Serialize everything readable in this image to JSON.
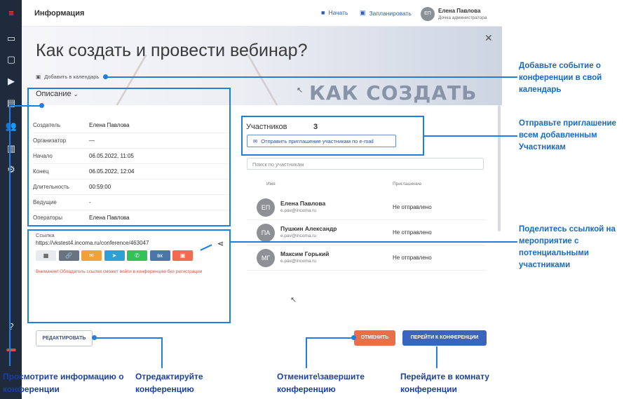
{
  "sidebar": {
    "icons": [
      "menu-icon",
      "calendar-icon",
      "chat-icon",
      "play-icon",
      "message-icon",
      "users-icon",
      "stats-icon",
      "settings-icon",
      "help-icon",
      "flag-icon"
    ]
  },
  "topbar": {
    "title": "Информация",
    "start_label": "Начать",
    "schedule_label": "Запланировать",
    "user_initials": "ЕП",
    "user_name": "Елена Павлова",
    "user_role": "Дочка администратора"
  },
  "hero": {
    "title": "Как создать и провести вебинар?",
    "bg_text": "КАК СОЗДАТЬ",
    "add_calendar": "Добавить в календарь"
  },
  "description": {
    "header": "Описание",
    "rows": [
      {
        "key": "Создатель",
        "value": "Елена Павлова"
      },
      {
        "key": "Организатор",
        "value": "—"
      },
      {
        "key": "Начало",
        "value": "06.05.2022, 11:05"
      },
      {
        "key": "Конец",
        "value": "06.05.2022, 12:04"
      },
      {
        "key": "Длительность",
        "value": "00:59:00"
      },
      {
        "key": "Ведущие",
        "value": "-"
      },
      {
        "key": "Операторы",
        "value": "Елена Павлова"
      }
    ]
  },
  "link": {
    "label": "Ссылка",
    "url": "https://vkstest4.incoma.ru/conference/463047",
    "buttons": [
      {
        "name": "qr-icon",
        "glyph": "▦",
        "color": "#e9eaee",
        "fg": "#333"
      },
      {
        "name": "copy-link-icon",
        "glyph": "🔗",
        "color": "#6b7280",
        "fg": "#fff"
      },
      {
        "name": "email-icon",
        "glyph": "✉",
        "color": "#f0a13a",
        "fg": "#fff"
      },
      {
        "name": "telegram-icon",
        "glyph": "➤",
        "color": "#2ea0d8",
        "fg": "#fff"
      },
      {
        "name": "whatsapp-icon",
        "glyph": "✆",
        "color": "#32c15a",
        "fg": "#fff"
      },
      {
        "name": "vk-icon",
        "glyph": "вк",
        "color": "#4a76a8",
        "fg": "#fff"
      },
      {
        "name": "calendar-icon",
        "glyph": "▣",
        "color": "#f26b51",
        "fg": "#fff"
      }
    ],
    "warning": "Внимание! Обладатель ссылки сможет войти в конференцию без регистрации"
  },
  "participants": {
    "title": "Участников",
    "count": "3",
    "invite_label": "Отправить приглашение участникам по e-mail",
    "search_placeholder": "Поиск по участникам",
    "col_name": "Имя",
    "col_invite": "Приглашение",
    "rows": [
      {
        "initials": "ЕП",
        "name": "Елена Павлова",
        "email": "e.pav@incoma.ru",
        "status": "Не отправлено"
      },
      {
        "initials": "ПА",
        "name": "Пушкин Александр",
        "email": "e.pav@incoma.ru",
        "status": "Не отправлено"
      },
      {
        "initials": "МГ",
        "name": "Максим Горький",
        "email": "e.pav@incoma.ru",
        "status": "Не отправлено"
      }
    ]
  },
  "actions": {
    "edit": "РЕДАКТИРОВАТЬ",
    "cancel": "ОТМЕНИТЬ",
    "go": "ПЕРЕЙТИ К КОНФЕРЕНЦИИ"
  },
  "annotations": {
    "calendar": "Добавьте событие о конференции в свой календарь",
    "invite": "Отправьте приглашение всем добавленным Участникам",
    "share": "Поделитесь ссылкой на мероприятие с потенциальными участниками",
    "view": "Просмотрите информацию о конференции",
    "edit": "Отредактируйте конференцию",
    "cancel": "Отмените\\завершите конференцию",
    "go": "Перейдите в комнату конференции"
  },
  "colors": {
    "sidebar": "#1f2a3c",
    "accent_blue": "#3b64be",
    "cancel_orange": "#ef6c4a",
    "annotation_blue": "#1f7fe0"
  }
}
